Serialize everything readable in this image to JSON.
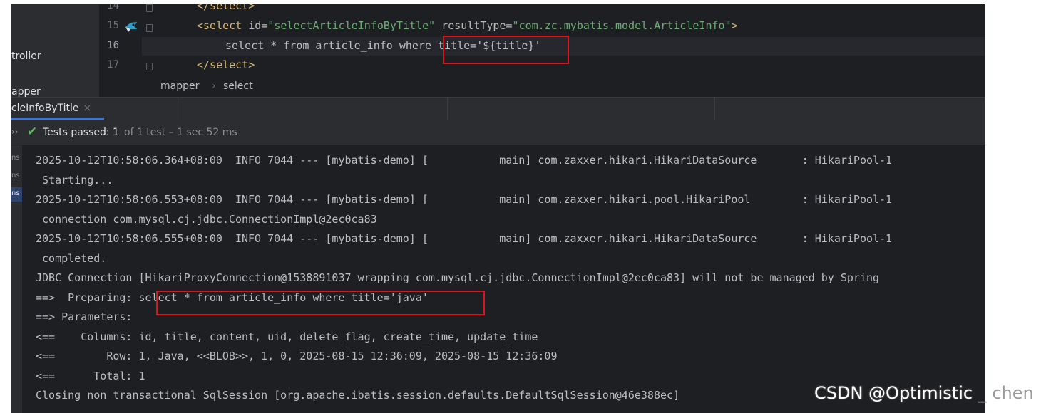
{
  "project_panel": {
    "items": [
      "troller",
      "apper"
    ]
  },
  "editor": {
    "lines": [
      {
        "number": "14",
        "text": "</select>"
      },
      {
        "number": "15",
        "tag_open": "<select",
        "attr1_name": " id=",
        "attr1_value": "\"selectArticleInfoByTitle\"",
        "attr2_name": " resultType=",
        "attr2_value": "\"com.zc.mybatis.model.ArticleInfo\"",
        "tag_close": ">"
      },
      {
        "number": "16",
        "text": "select * from article_info where title='${title}'"
      },
      {
        "number": "17",
        "text": "</select>"
      }
    ]
  },
  "breadcrumb": {
    "items": [
      "mapper",
      "select"
    ],
    "separator": "›"
  },
  "run_window": {
    "tab_label": "icleInfoByTitle",
    "tab_close": "×",
    "status": {
      "chevron": "››",
      "check_icon": "check-icon",
      "passed": "Tests passed:",
      "count": "1",
      "detail": "of 1 test – 1 sec 52 ms"
    },
    "tree_items": [
      "ns",
      "ns",
      "ns"
    ],
    "console_lines": [
      "2025-10-12T10:58:06.364+08:00  INFO 7044 --- [mybatis-demo] [           main] com.zaxxer.hikari.HikariDataSource       : HikariPool-1",
      " Starting...",
      "2025-10-12T10:58:06.553+08:00  INFO 7044 --- [mybatis-demo] [           main] com.zaxxer.hikari.pool.HikariPool        : HikariPool-1",
      " connection com.mysql.cj.jdbc.ConnectionImpl@2ec0ca83",
      "2025-10-12T10:58:06.555+08:00  INFO 7044 --- [mybatis-demo] [           main] com.zaxxer.hikari.HikariDataSource       : HikariPool-1",
      " completed.",
      "JDBC Connection [HikariProxyConnection@1538891037 wrapping com.mysql.cj.jdbc.ConnectionImpl@2ec0ca83] will not be managed by Spring",
      "==>  Preparing: select * from article_info where title='java'",
      "==> Parameters: ",
      "<==    Columns: id, title, content, uid, delete_flag, create_time, update_time",
      "<==        Row: 1, Java, <<BLOB>>, 1, 0, 2025-08-15 12:36:09, 2025-08-15 12:36:09",
      "<==      Total: 1",
      "Closing non transactional SqlSession [org.apache.ibatis.session.defaults.DefaultSqlSession@46e388ec]"
    ]
  },
  "watermark": {
    "main": "CSDN @Optimistic",
    "tail": " _ chen"
  },
  "colors": {
    "highlight_box": "#e0131b",
    "editor_bg": "#1e1f22",
    "panel_bg": "#2b2d30",
    "tag": "#d5b778",
    "string": "#6aab73",
    "pass_green": "#5fb865"
  }
}
